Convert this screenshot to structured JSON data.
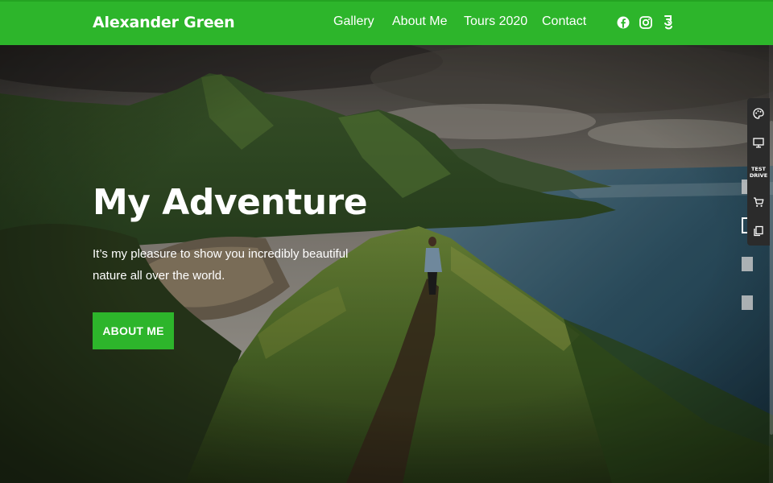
{
  "header": {
    "brand": "Alexander Green",
    "nav": [
      "Gallery",
      "About Me",
      "Tours 2020",
      "Contact"
    ],
    "social": [
      "facebook-icon",
      "instagram-icon",
      "social-icon"
    ]
  },
  "hero": {
    "title": "My Adventure",
    "subtitle": "It’s my pleasure to show you incredibly beautiful nature all over the world.",
    "button_label": "ABOUT ME",
    "slide_count": 4,
    "active_slide": 2
  },
  "toolbar": {
    "items": [
      "palette-icon",
      "monitor-icon",
      "test-drive",
      "cart-icon",
      "copy-icon"
    ],
    "test_drive_line1": "TEST",
    "test_drive_line2": "DRIVE"
  },
  "colors": {
    "accent": "#2db52b",
    "text_light": "#ffffff",
    "toolbar_bg": "#2b2b2b"
  }
}
